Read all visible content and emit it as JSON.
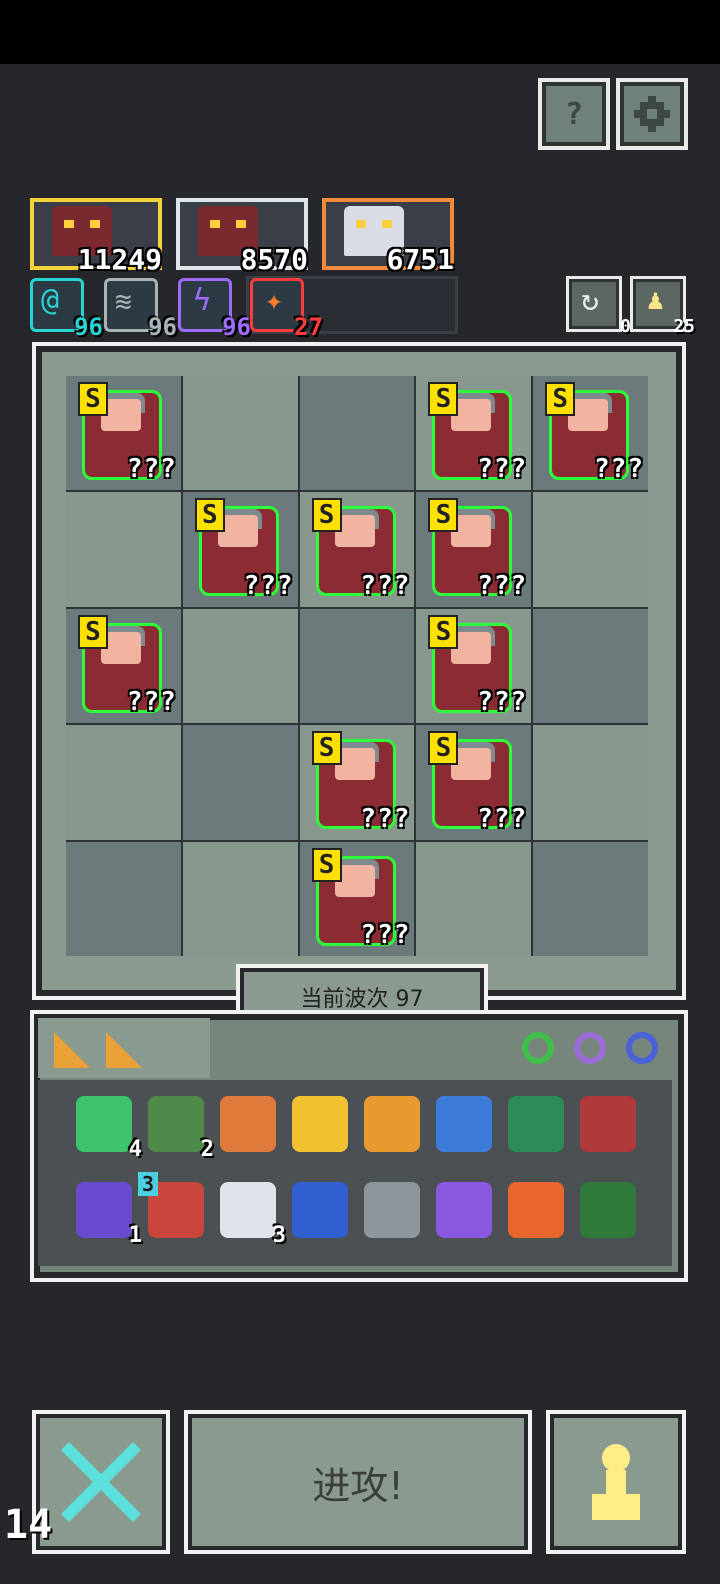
{
  "bosses": [
    {
      "hp": "11249",
      "frame_color": "#f5d23a"
    },
    {
      "hp": "8570",
      "frame_color": "#dfe6ea"
    },
    {
      "hp": "6751",
      "frame_color": "#f28a3c"
    }
  ],
  "elements": [
    {
      "icon": "spiral-icon",
      "count": "96",
      "color": "#2ad3d3"
    },
    {
      "icon": "wind-icon",
      "count": "96",
      "color": "#a9b4b6"
    },
    {
      "icon": "lightning-icon",
      "count": "96",
      "color": "#a06bff"
    },
    {
      "icon": "fire-icon",
      "count": "27",
      "color": "#ff3b3b"
    }
  ],
  "top_buttons": {
    "help_label": "?",
    "settings_icon": "gear-icon"
  },
  "mini_buttons": [
    {
      "icon": "refresh-icon",
      "count": "0"
    },
    {
      "icon": "pawn-icon",
      "count": "25"
    }
  ],
  "board": {
    "rows": 5,
    "cols": 5,
    "units": [
      {
        "row": 0,
        "col": 0,
        "rank": "S",
        "label": "???",
        "kind": "crowned-warrior"
      },
      {
        "row": 0,
        "col": 3,
        "rank": "S",
        "label": "???",
        "kind": "dark-hat-rogue"
      },
      {
        "row": 0,
        "col": 4,
        "rank": "S",
        "label": "???",
        "kind": "helmet-guard"
      },
      {
        "row": 1,
        "col": 1,
        "rank": "S",
        "label": "???",
        "kind": "helmet-guard"
      },
      {
        "row": 1,
        "col": 2,
        "rank": "S",
        "label": "???",
        "kind": "bandana-fighter"
      },
      {
        "row": 1,
        "col": 3,
        "rank": "S",
        "label": "???",
        "kind": "armored-knight"
      },
      {
        "row": 2,
        "col": 0,
        "rank": "S",
        "label": "???",
        "kind": "blonde-mage"
      },
      {
        "row": 2,
        "col": 3,
        "rank": "S",
        "label": "???",
        "kind": "armored-knight"
      },
      {
        "row": 3,
        "col": 2,
        "rank": "S",
        "label": "???",
        "kind": "blonde-girl"
      },
      {
        "row": 3,
        "col": 3,
        "rank": "S",
        "label": "???",
        "kind": "red-robed-priest"
      },
      {
        "row": 4,
        "col": 2,
        "rank": "S",
        "label": "???",
        "kind": "armored-knight"
      }
    ]
  },
  "wave_text": "当前波次 97",
  "inventory": {
    "tab_icons": [
      "cheese-icon",
      "cheese-icon"
    ],
    "rings": [
      {
        "icon": "green-ring-icon",
        "color": "#3fbf4a"
      },
      {
        "icon": "purple-ring-icon",
        "color": "#9a6bd6"
      },
      {
        "icon": "blue-ring-icon",
        "color": "#4b62d8"
      }
    ],
    "items": [
      {
        "icon": "emerald-icon",
        "count": "4",
        "color": "#3fc36a"
      },
      {
        "icon": "green-scarf-icon",
        "count": "2",
        "color": "#4f8a4a"
      },
      {
        "icon": "leather-armor-icon",
        "count": "",
        "color": "#e07a3a"
      },
      {
        "icon": "goblet-icon",
        "count": "",
        "color": "#f0c030"
      },
      {
        "icon": "fire-scroll-icon",
        "count": "",
        "color": "#e89a2e"
      },
      {
        "icon": "water-drop-icon",
        "count": "",
        "color": "#3c7bd8"
      },
      {
        "icon": "green-tile-icon",
        "count": "",
        "color": "#2f8a5a"
      },
      {
        "icon": "arrow-icon",
        "count": "",
        "color": "#b03a3a"
      },
      {
        "icon": "potion-icon",
        "count": "1",
        "color": "#6a4bd0"
      },
      {
        "icon": "cape-icon",
        "count": "",
        "badge": "3",
        "color": "#c9473a"
      },
      {
        "icon": "claw-icon",
        "count": "3",
        "color": "#e0e4ea"
      },
      {
        "icon": "blue-drop-scroll-icon",
        "count": "",
        "color": "#2f5fd0"
      },
      {
        "icon": "shuriken-icon",
        "count": "",
        "color": "#8c969c"
      },
      {
        "icon": "purple-swirl-icon",
        "count": "",
        "color": "#8a58e0"
      },
      {
        "icon": "flame-scroll-icon",
        "count": "",
        "color": "#e8652e"
      },
      {
        "icon": "vine-tile-icon",
        "count": "",
        "color": "#2f7a3a"
      }
    ]
  },
  "bottom": {
    "attack_label": "进攻!",
    "left_icon": "cross-swords-icon",
    "right_icon": "pawn-icon",
    "fps": "14"
  }
}
